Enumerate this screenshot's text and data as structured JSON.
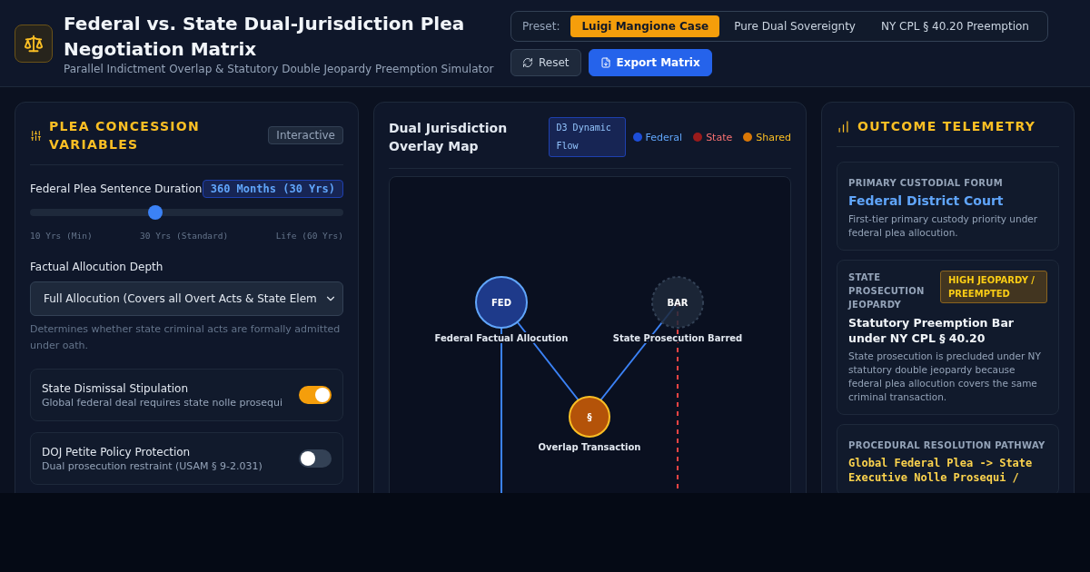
{
  "header": {
    "title": "Federal vs. State Dual-Jurisdiction Plea Negotiation Matrix",
    "subtitle": "Parallel Indictment Overlap & Statutory Double Jeopardy Preemption Simulator"
  },
  "presets": {
    "label": "Preset:",
    "items": [
      {
        "label": "Luigi Mangione Case",
        "selected": true
      },
      {
        "label": "Pure Dual Sovereignty",
        "selected": false
      },
      {
        "label": "NY CPL § 40.20 Preemption",
        "selected": false
      }
    ]
  },
  "actions": {
    "reset": "Reset",
    "export": "Export Matrix"
  },
  "left_panel": {
    "title": "PLEA CONCESSION VARIABLES",
    "badge": "Interactive",
    "slider": {
      "label": "Federal Plea Sentence Duration",
      "reading": "360 Months (30 Yrs)",
      "level": 0.4,
      "ticks": [
        "10 Yrs (Min)",
        "30 Yrs (Standard)",
        "Life (60 Yrs)"
      ]
    },
    "select": {
      "label": "Factual Allocution Depth",
      "value": "Full Allocution (Covers all Overt Acts & State Elem",
      "help": "Determines whether state criminal acts are formally admitted under oath."
    },
    "toggles": [
      {
        "title": "State Dismissal Stipulation",
        "description": "Global federal deal requires state nolle prosequi",
        "on": true
      },
      {
        "title": "DOJ Petite Policy Protection",
        "description": "Dual prosecution restraint (USAM § 9-2.031)",
        "on": false
      }
    ]
  },
  "map_panel": {
    "title": "Dual Jurisdiction Overlay Map",
    "badge": "D3 Dynamic Flow",
    "legend": [
      {
        "label": "Federal",
        "color": "#1d4ed8"
      },
      {
        "label": "State",
        "color": "#991b1b"
      },
      {
        "label": "Shared",
        "color": "#d97706"
      }
    ],
    "nodes": [
      {
        "kind": "federal",
        "symbol": "FED",
        "label": "Federal Factual Allocution"
      },
      {
        "kind": "barred",
        "symbol": "BAR",
        "label": "State Prosecution Barred"
      },
      {
        "kind": "shared",
        "symbol": "§",
        "label": "Overlap Transaction"
      }
    ]
  },
  "outcome_panel": {
    "title": "OUTCOME TELEMETRY",
    "cards": [
      {
        "kind": "forum",
        "label": "PRIMARY CUSTODIAL FORUM",
        "value": "Federal District Court",
        "description": "First-tier primary custody priority under federal plea allocution."
      },
      {
        "kind": "jeopardy",
        "label": "STATE PROSECUTION JEOPARDY",
        "tag": "HIGH JEOPARDY / PREEMPTED",
        "value": "Statutory Preemption Bar under NY CPL § 40.20",
        "description": "State prosecution is precluded under NY statutory double jeopardy because federal plea allocution covers the same criminal transaction."
      },
      {
        "kind": "pathway",
        "label": "PROCEDURAL RESOLUTION PATHWAY",
        "value": "Global Federal Plea -> State Executive Nolle Prosequi /"
      }
    ]
  }
}
